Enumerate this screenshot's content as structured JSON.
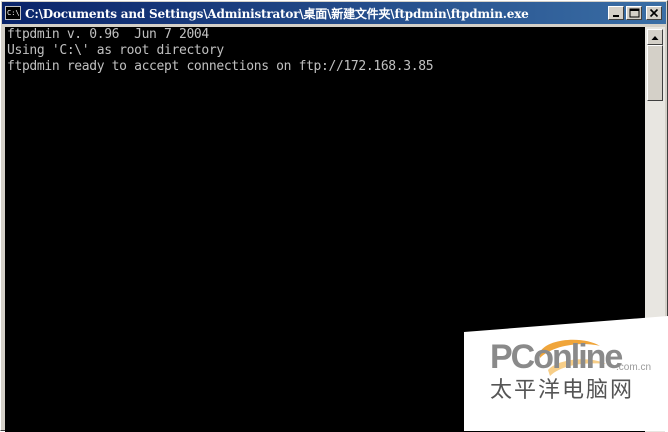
{
  "window": {
    "title": "C:\\Documents and Settings\\Administrator\\桌面\\新建文件夹\\ftpdmin\\ftpdmin.exe",
    "icon_label": "C:\\",
    "icon": "console-icon"
  },
  "caption_buttons": {
    "minimize": "minimize-icon",
    "maximize": "maximize-icon",
    "close": "close-icon"
  },
  "console": {
    "lines": [
      "ftpdmin v. 0.96  Jun 7 2004",
      "Using 'C:\\' as root directory",
      "ftpdmin ready to accept connections on ftp://172.168.3.85"
    ],
    "background": "#000000",
    "foreground": "#c0c0c0"
  },
  "watermark": {
    "brand": "PConline",
    "domain": ".com.cn",
    "chinese": "太平洋电脑网"
  }
}
